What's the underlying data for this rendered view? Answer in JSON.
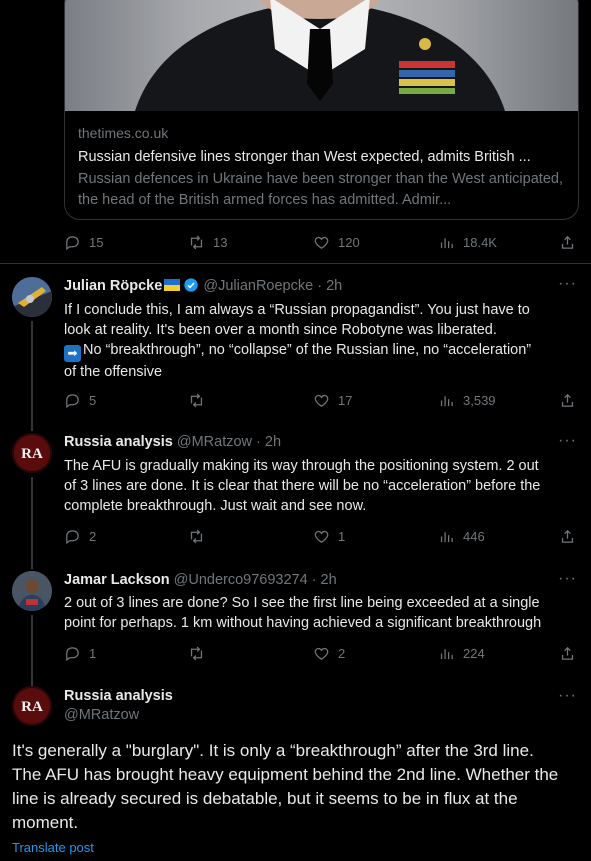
{
  "card": {
    "domain": "thetimes.co.uk",
    "title": "Russian defensive lines stronger than West expected, admits British ...",
    "description": "Russian defences in Ukraine have been stronger than the West anticipated, the head of the British armed forces has admitted. Admir..."
  },
  "top_actions": {
    "replies": "15",
    "reposts": "13",
    "likes": "120",
    "views": "18.4K"
  },
  "posts": [
    {
      "name": "Julian Röpcke",
      "handle": "@JulianRoepcke",
      "time": "· 2h",
      "flag": "ukraine",
      "verified": true,
      "lines": [
        "If I conclude this, I am always a “Russian propagandist”. You just have to",
        "look at reality. It's been over a month since Robotyne was liberated.",
        "No “breakthrough”, no “collapse” of the Russian line, no “acceleration”",
        "of the offensive"
      ],
      "arrow_emoji": "➡",
      "actions": {
        "replies": "5",
        "reposts": "",
        "likes": "17",
        "views": "3,539"
      }
    },
    {
      "name": "Russia analysis",
      "handle": "@MRatzow",
      "time": "· 2h",
      "avatar_text": "RA",
      "lines": [
        "The AFU is gradually making its way through the positioning system. 2 out",
        "of 3 lines are done. It is clear that there will be no “acceleration” before the",
        "complete breakthrough. Just wait and see now."
      ],
      "actions": {
        "replies": "2",
        "reposts": "",
        "likes": "1",
        "views": "446"
      }
    },
    {
      "name": "Jamar Lackson",
      "handle": "@Underco97693274",
      "time": "· 2h",
      "lines": [
        "2 out of 3 lines are done? So I see the first line being exceeded at a single",
        "point for perhaps. 1 km without having achieved a significant breakthrough"
      ],
      "actions": {
        "replies": "1",
        "reposts": "",
        "likes": "2",
        "views": "224"
      }
    }
  ],
  "main_post": {
    "name": "Russia analysis",
    "handle": "@MRatzow",
    "avatar_text": "RA",
    "lines": [
      "It's generally a \"burglary\". It is only a “breakthrough” after the 3rd line.",
      "The AFU has brought heavy equipment behind the 2nd line. Whether the",
      "line is already secured is debatable, but it seems to be in flux at the",
      "moment."
    ],
    "translate": "Translate post"
  },
  "more_label": "···",
  "colors": {
    "background": "#000000",
    "text": "#e7e9ea",
    "muted": "#71767b",
    "accent": "#1d9bf0",
    "border": "#2f3336"
  }
}
